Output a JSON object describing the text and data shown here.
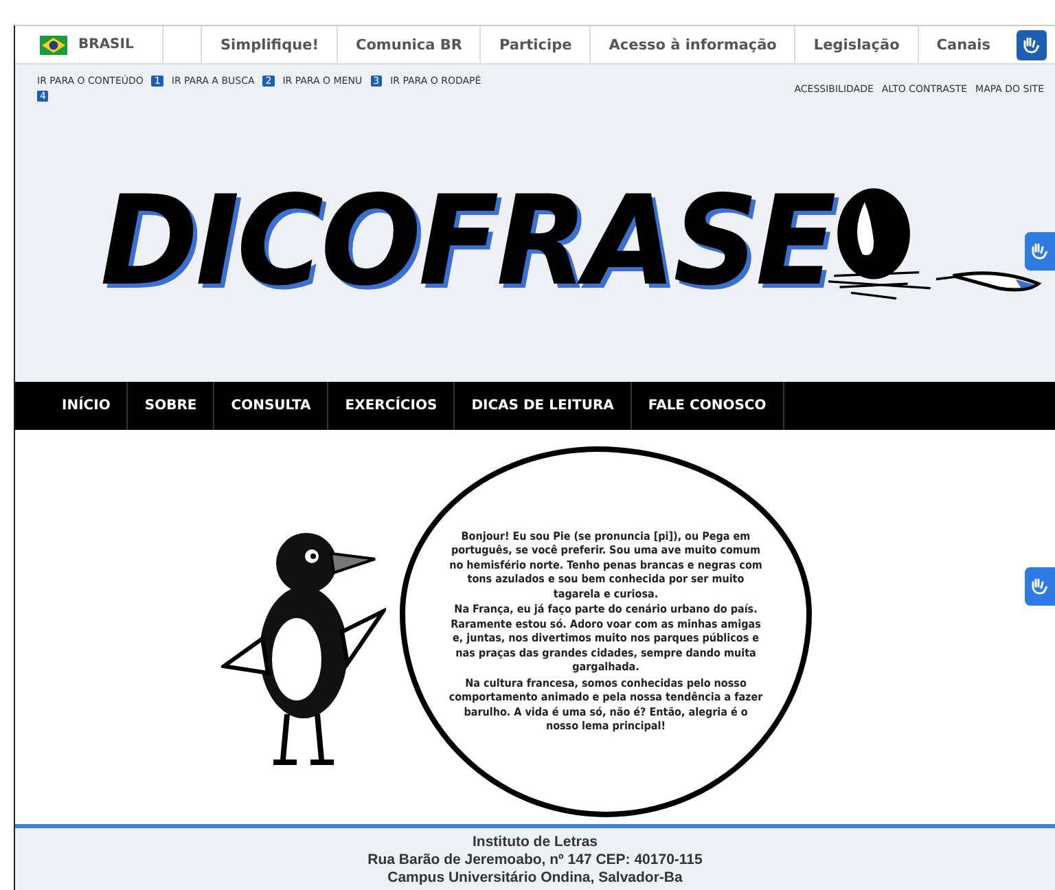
{
  "gov_bar": {
    "country": "BRASIL",
    "links": [
      "Simplifique!",
      "Comunica BR",
      "Participe",
      "Acesso à informação",
      "Legislação",
      "Canais"
    ]
  },
  "skip_links": [
    {
      "label": "IR PARA O CONTEÚDO",
      "number": "1"
    },
    {
      "label": "IR PARA A BUSCA",
      "number": "2"
    },
    {
      "label": "IR PARA O MENU",
      "number": "3"
    },
    {
      "label": "IR PARA O RODAPÉ",
      "number": "4"
    }
  ],
  "accessibility_links": [
    "ACESSIBILIDADE",
    "ALTO CONTRASTE",
    "MAPA DO SITE"
  ],
  "logo": {
    "text": "DICOFRASE"
  },
  "nav": [
    "INÍCIO",
    "SOBRE",
    "CONSULTA",
    "EXERCÍCIOS",
    "DICAS DE LEITURA",
    "FALE CONOSCO"
  ],
  "speech": [
    "Bonjour! Eu sou Pie (se pronuncia [pi]), ou Pega em português, se você preferir. Sou uma ave muito comum no hemisfério norte. Tenho penas brancas e negras com tons azulados e sou bem conhecida por ser muito tagarela e curiosa.",
    "Na França, eu já faço parte do cenário urbano do país. Raramente estou só. Adoro voar com as minhas amigas e, juntas, nos divertimos muito nos parques públicos e nas praças das grandes cidades, sempre dando muita gargalhada.",
    "Na cultura francesa, somos conhecidas pelo nosso comportamento animado e pela nossa tendência a fazer barulho. A vida é uma só, não é? Então, alegria é o nosso lema principal!"
  ],
  "footer": [
    "Instituto de Letras",
    "Rua Barão de Jeremoabo, nº 147 CEP: 40170-115",
    "Campus Universitário Ondina, Salvador-Ba"
  ]
}
